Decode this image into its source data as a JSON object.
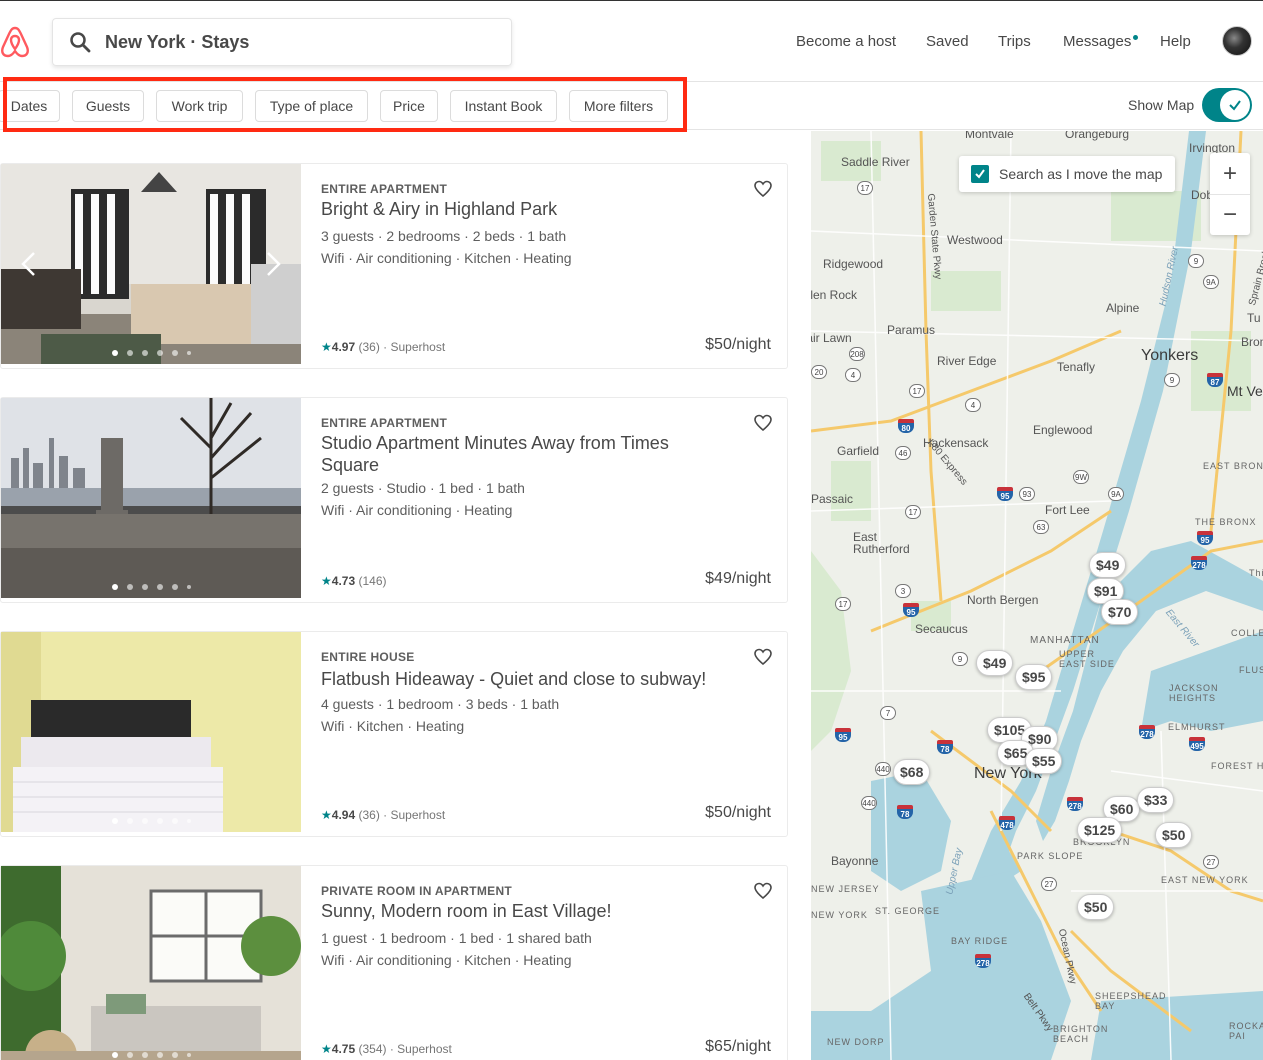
{
  "header": {
    "search_text": "New York · Stays",
    "nav": [
      "Become a host",
      "Saved",
      "Trips",
      "Messages",
      "Help"
    ]
  },
  "filters": {
    "chips": [
      "Dates",
      "Guests",
      "Work trip",
      "Type of place",
      "Price",
      "Instant Book",
      "More filters"
    ],
    "show_map_label": "Show Map",
    "show_map_on": true
  },
  "listings": [
    {
      "kind": "ENTIRE APARTMENT",
      "title": "Bright & Airy in Highland Park",
      "details": "3 guests · 2 bedrooms · 2 beds · 1 bath",
      "amenities": "Wifi · Air conditioning · Kitchen · Heating",
      "rating": "4.97",
      "reviews": "(36)",
      "badge": "· Superhost",
      "price": "$50/night"
    },
    {
      "kind": "ENTIRE APARTMENT",
      "title": "Studio Apartment Minutes Away from Times Square",
      "details": "2 guests · Studio · 1 bed · 1 bath",
      "amenities": "Wifi · Air conditioning · Heating",
      "rating": "4.73",
      "reviews": "(146)",
      "badge": "",
      "price": "$49/night"
    },
    {
      "kind": "ENTIRE HOUSE",
      "title": "Flatbush Hideaway - Quiet and close to subway!",
      "details": "4 guests · 1 bedroom · 3 beds · 1 bath",
      "amenities": "Wifi · Kitchen · Heating",
      "rating": "4.94",
      "reviews": "(36)",
      "badge": "· Superhost",
      "price": "$50/night"
    },
    {
      "kind": "PRIVATE ROOM IN APARTMENT",
      "title": "Sunny, Modern room in East Village!",
      "details": "1 guest · 1 bedroom · 1 bed · 1 shared bath",
      "amenities": "Wifi · Air conditioning · Kitchen · Heating",
      "rating": "4.75",
      "reviews": "(354)",
      "badge": "· Superhost",
      "price": "$65/night"
    }
  ],
  "map": {
    "search_as_move_label": "Search as I move the map",
    "search_as_move_checked": true,
    "zoom_in": "+",
    "zoom_out": "−",
    "places": [
      "Montvale",
      "Orangeburg",
      "Irvington",
      "Saddle River",
      "Dobbs",
      "Westwood",
      "Ridgewood",
      "Glen Rock",
      "Alpine",
      "Paramus",
      "Fair Lawn",
      "River Edge",
      "Tenafly",
      "Yonkers",
      "Mt Ve",
      "Englewood",
      "Hackensack",
      "Garfield",
      "Passaic",
      "Fort Lee",
      "East Rutherford",
      "North Bergen",
      "Secaucus",
      "MANHATTAN",
      "UPPER EAST SIDE",
      "JACKSON HEIGHTS",
      "ELMHURST",
      "FOREST H",
      "New York",
      "BROOKLYN",
      "PARK SLOPE",
      "EAST NEW YORK",
      "Bayonne",
      "NEW JERSEY",
      "NEW YORK",
      "ST. GEORGE",
      "BAY RIDGE",
      "SHEEPSHEAD BAY",
      "BRIGHTON BEACH",
      "NEW DORP",
      "ROCKA PAI",
      "THE BRONX",
      "EAST BRON",
      "COLLEGE",
      "FLUS",
      "Upper Bay",
      "Ocean Pkwy",
      "Belt Pkwy",
      "Hudson River",
      "East River",
      "Garden State Pkwy",
      "I-80 Express",
      "Sprain Brook Pkwy",
      "Tu",
      "Bron",
      "Thi"
    ],
    "prices": [
      "$49",
      "$91",
      "$70",
      "$49",
      "$95",
      "$105",
      "$90",
      "$65",
      "$55",
      "$68",
      "$60",
      "$33",
      "$125",
      "$50",
      "$50"
    ]
  }
}
